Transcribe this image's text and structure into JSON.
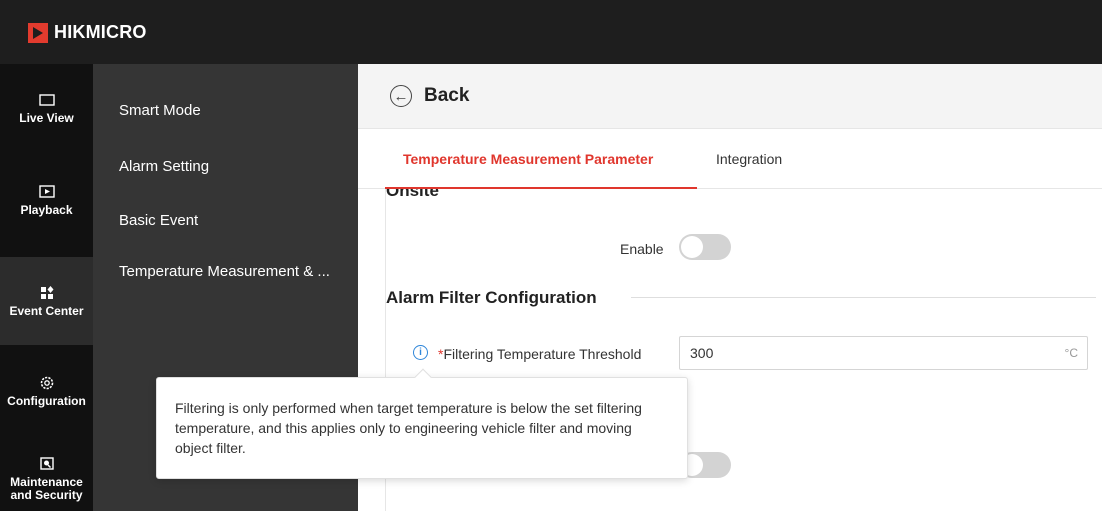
{
  "brand": {
    "name": "HIKMICRO",
    "accent": "#e23b2e"
  },
  "nav": [
    {
      "label": "Live View",
      "icon": "monitor-icon"
    },
    {
      "label": "Playback",
      "icon": "play-screen-icon"
    },
    {
      "label": "Event Center",
      "icon": "grid-icon",
      "active": true
    },
    {
      "label": "Configuration",
      "icon": "gear-icon"
    },
    {
      "label": "Maintenance and Security",
      "icon": "maintenance-icon"
    }
  ],
  "submenu": [
    {
      "label": "Smart Mode"
    },
    {
      "label": "Alarm Setting"
    },
    {
      "label": "Basic Event"
    },
    {
      "label": "Temperature Measurement & ..."
    }
  ],
  "header": {
    "back_label": "Back"
  },
  "tabs": [
    {
      "label": "Temperature Measurement Parameter",
      "active": true
    },
    {
      "label": "Integration"
    }
  ],
  "content": {
    "partial_section": "Onsite",
    "enable_label": "Enable",
    "enable_value": false,
    "section_title": "Alarm Filter Configuration",
    "threshold_required": "*",
    "threshold_label": "Filtering Temperature Threshold",
    "threshold_value": "300",
    "threshold_unit": "°C",
    "second_toggle_value": false
  },
  "tooltip": {
    "text": "Filtering is only performed when target temperature is below the set filtering temperature, and this applies only to engineering vehicle filter and moving object filter."
  },
  "colors": {
    "accent_red": "#e0362d",
    "info_blue": "#2f86d9"
  }
}
